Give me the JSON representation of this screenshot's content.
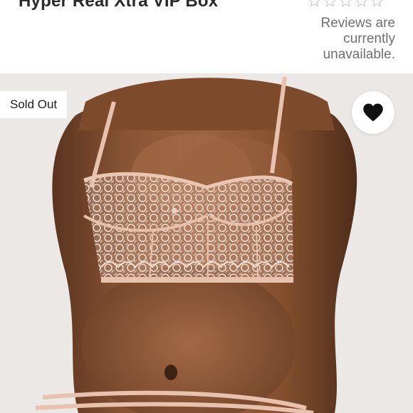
{
  "product": {
    "title": "Hyper Real Xtra VIP Box"
  },
  "reviews": {
    "rating_stars": 0,
    "max_stars": 5,
    "status_text": "Reviews are currently unavailable."
  },
  "listing": {
    "badge": "Sold Out",
    "like_icon": "heart-icon"
  },
  "colors": {
    "star_outline": "#c9c9c9",
    "badge_bg": "#ffffff",
    "heart": "#111111",
    "lace_trim": "#e9c2ad"
  }
}
